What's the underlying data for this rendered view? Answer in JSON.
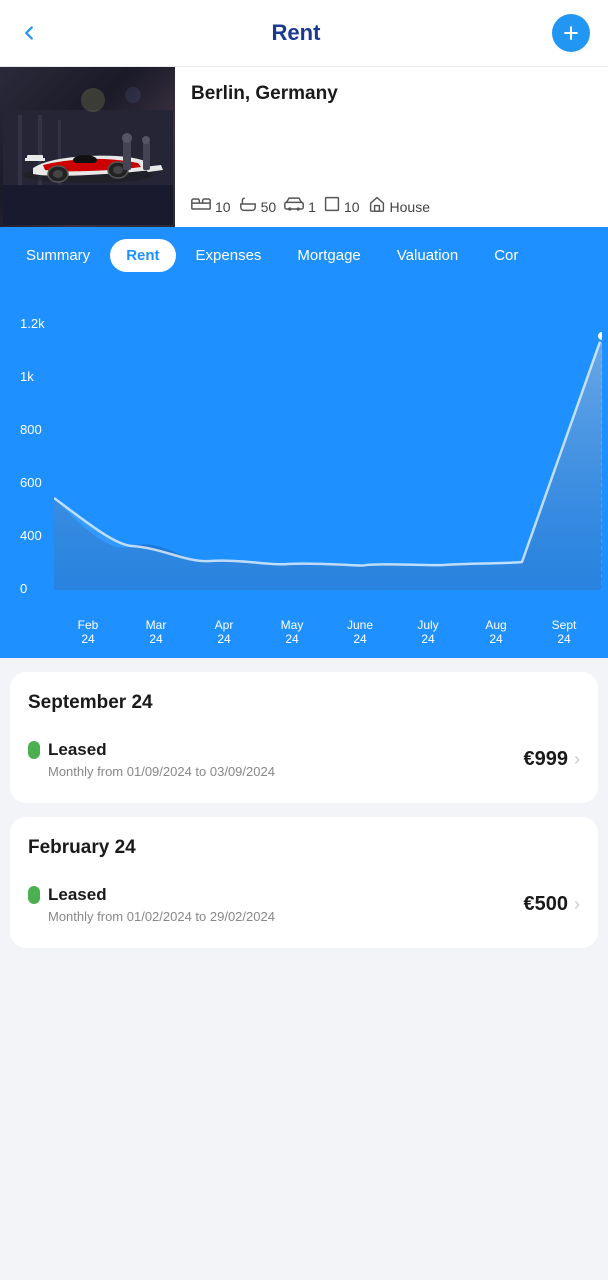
{
  "header": {
    "title": "Rent",
    "back_label": "←",
    "add_label": "+"
  },
  "property": {
    "location": "Berlin, Germany",
    "stats": [
      {
        "icon": "🛏",
        "value": "10",
        "name": "beds"
      },
      {
        "icon": "🛁",
        "value": "50",
        "name": "baths"
      },
      {
        "icon": "🚗",
        "value": "1",
        "name": "garage"
      },
      {
        "icon": "⬜",
        "value": "10",
        "name": "area"
      },
      {
        "icon": "🏠",
        "value": "House",
        "name": "type"
      }
    ]
  },
  "tabs": [
    {
      "label": "Summary",
      "active": false
    },
    {
      "label": "Rent",
      "active": true
    },
    {
      "label": "Expenses",
      "active": false
    },
    {
      "label": "Mortgage",
      "active": false
    },
    {
      "label": "Valuation",
      "active": false
    },
    {
      "label": "Cor",
      "active": false
    }
  ],
  "chart": {
    "y_labels": [
      "1.2k",
      "1k",
      "800",
      "600",
      "400",
      "0"
    ],
    "x_labels": [
      {
        "line1": "Feb",
        "line2": "24"
      },
      {
        "line1": "Mar",
        "line2": "24"
      },
      {
        "line1": "Apr",
        "line2": "24"
      },
      {
        "line1": "May",
        "line2": "24"
      },
      {
        "line1": "June",
        "line2": "24"
      },
      {
        "line1": "July",
        "line2": "24"
      },
      {
        "line1": "Aug",
        "line2": "24"
      },
      {
        "line1": "Sept",
        "line2": "24"
      }
    ]
  },
  "sections": [
    {
      "title": "September 24",
      "items": [
        {
          "label": "Leased",
          "period": "Monthly from 01/09/2024 to 03/09/2024",
          "amount": "€999"
        }
      ]
    },
    {
      "title": "February 24",
      "items": [
        {
          "label": "Leased",
          "period": "Monthly from 01/02/2024 to 29/02/2024",
          "amount": "€500"
        }
      ]
    }
  ]
}
